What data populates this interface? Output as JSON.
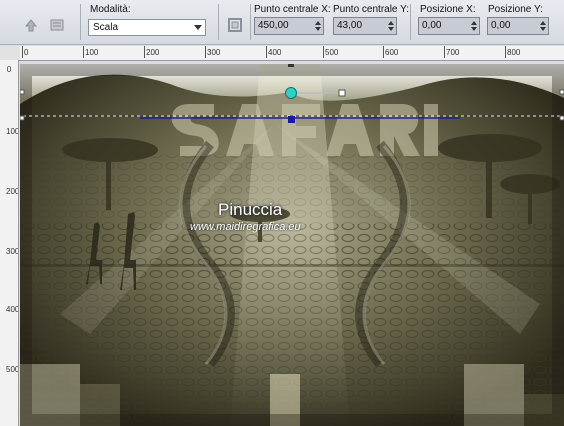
{
  "toolbar": {
    "mode_label": "Modalità:",
    "mode_value": "Scala",
    "center_x_label": "Punto centrale X:",
    "center_x_value": "450,00",
    "center_y_label": "Punto centrale Y:",
    "center_y_value": "43,00",
    "pos_x_label": "Posizione X:",
    "pos_x_value": "0,00",
    "pos_y_label": "Posizione Y:",
    "pos_y_value": "0,00"
  },
  "ruler": {
    "h_ticks": [
      "0",
      "100",
      "200",
      "300",
      "400",
      "500",
      "600",
      "700",
      "800"
    ],
    "v_ticks": [
      "0",
      "100",
      "200",
      "300",
      "400",
      "500"
    ]
  },
  "canvas": {
    "title_art": "SAFARI",
    "watermark_name": "Pinuccia",
    "watermark_url": "www.maidiregrafica.eu"
  },
  "colors": {
    "handle": "#2fd0c8",
    "guide": "#1a1aa0",
    "sepia_dark": "#3e3a26",
    "sepia_light": "#c8c4a8"
  }
}
